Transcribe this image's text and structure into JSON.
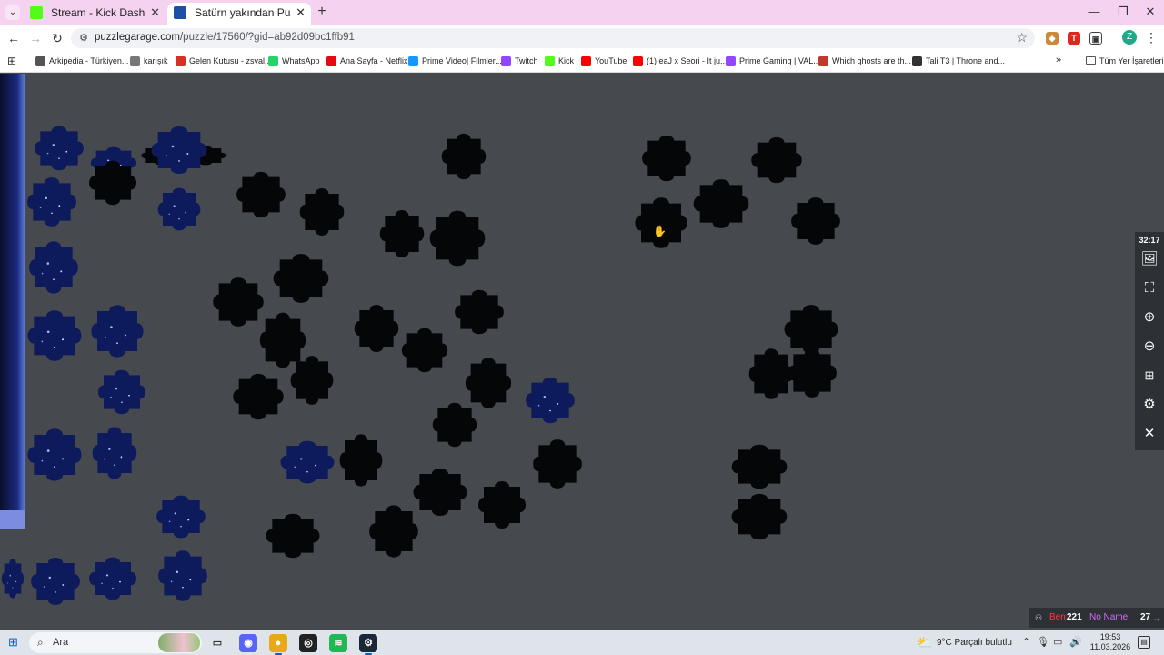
{
  "browser": {
    "tabs": [
      {
        "label": "Stream - Kick Dashboard",
        "favicon_color": "#53fc18"
      },
      {
        "label": "Satürn yakından Puzzle ve Yapb",
        "favicon_color": "#1d4fa6"
      }
    ],
    "url_host": "puzzlegarage.com",
    "url_path": "/puzzle/17560/?gid=ab92d09bc1ffb91",
    "profile_initial": "Z"
  },
  "bookmarks": [
    {
      "label": "Arkipedia - Türkiyen...",
      "icon_color": "#555555"
    },
    {
      "label": "karışık",
      "icon_color": "#777777"
    },
    {
      "label": "Gelen Kutusu - zsyal...",
      "icon_color": "#d93025"
    },
    {
      "label": "WhatsApp",
      "icon_color": "#25d366"
    },
    {
      "label": "Ana Sayfa - Netflix",
      "icon_color": "#e50914"
    },
    {
      "label": "Prime Video| Filmler...",
      "icon_color": "#1399ff"
    },
    {
      "label": "Twitch",
      "icon_color": "#9146ff"
    },
    {
      "label": "Kick",
      "icon_color": "#53fc18"
    },
    {
      "label": "YouTube",
      "icon_color": "#ff0000"
    },
    {
      "label": "(1) eaJ x Seori - It ju...",
      "icon_color": "#ff0000"
    },
    {
      "label": "Prime Gaming | VAL...",
      "icon_color": "#9146ff"
    },
    {
      "label": "Which ghosts are th...",
      "icon_color": "#c0392b"
    },
    {
      "label": "Tali T3 | Throne and...",
      "icon_color": "#333333"
    }
  ],
  "bookmarks_all_label": "Tüm Yer İşaretleri",
  "game": {
    "timer": "32:17",
    "players": [
      {
        "name": "Ben:",
        "score": "221",
        "color": "#ff3b3b"
      },
      {
        "name": "No Name:",
        "score": "27",
        "color": "#d46bff"
      }
    ]
  },
  "taskbar": {
    "search_label": "Ara",
    "weather": "9°C  Parçalı bulutlu",
    "time": "19:53",
    "date": "11.03.2026"
  },
  "colors": {
    "board_bg": "#464a4f",
    "piece_dark": "#050608",
    "piece_blue": "#0d1a5c"
  }
}
